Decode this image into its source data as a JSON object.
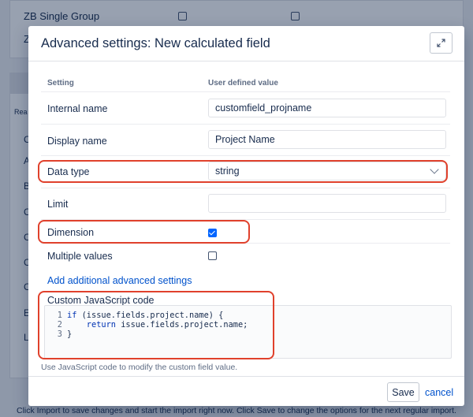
{
  "background": {
    "group_row_label": "ZB Single Group",
    "row2_letter": "Z",
    "side_label": "Rea",
    "side_letters": [
      "C",
      "A",
      "B",
      "C",
      "C",
      "C",
      "C",
      "E",
      "L"
    ],
    "footer_text": "Click Import to save changes and start the import right now. Click Save to change the options for the next regular import."
  },
  "modal": {
    "title": "Advanced settings: New calculated field",
    "expand_icon": "expand-diagonal-icon",
    "columns": {
      "setting": "Setting",
      "value": "User defined value"
    },
    "rows": {
      "internal_name": {
        "label": "Internal name",
        "value": "customfield_projname"
      },
      "display_name": {
        "label": "Display name",
        "value": "Project Name"
      },
      "data_type": {
        "label": "Data type",
        "value": "string"
      },
      "limit": {
        "label": "Limit",
        "value": ""
      },
      "dimension": {
        "label": "Dimension",
        "checked": true
      },
      "multiple_values": {
        "label": "Multiple values",
        "checked": false
      }
    },
    "add_link": "Add additional advanced settings",
    "code": {
      "label": "Custom JavaScript code",
      "lines": [
        {
          "num": "1",
          "kw": "if",
          "rest": " (issue.fields.project.name) {"
        },
        {
          "num": "2",
          "kw": "    return",
          "rest": " issue.fields.project.name;"
        },
        {
          "num": "3",
          "kw": "",
          "rest": "}"
        }
      ],
      "helper": "Use JavaScript code to modify the custom field value."
    },
    "footer": {
      "save": "Save",
      "cancel": "cancel"
    }
  },
  "colors": {
    "accent": "#0052cc",
    "checkbox": "#0065ff",
    "highlight": "#e0412c"
  }
}
